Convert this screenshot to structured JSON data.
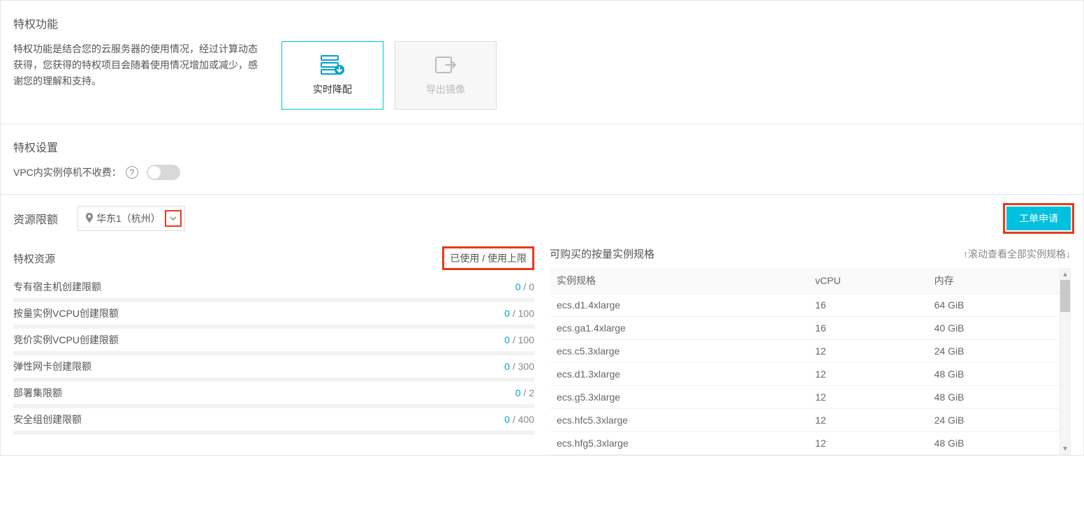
{
  "features": {
    "title": "特权功能",
    "desc": "特权功能是结合您的云服务器的使用情况，经过计算动态获得，您获得的特权项目会随着使用情况增加或减少，感谢您的理解和支持。",
    "cards": {
      "downgrade": "实时降配",
      "export_image": "导出镜像"
    }
  },
  "settings": {
    "title": "特权设置",
    "vpc_stop_no_charge": "VPC内实例停机不收费："
  },
  "quota": {
    "title": "资源限额",
    "region": "华东1（杭州）",
    "apply_label": "工单申请"
  },
  "left": {
    "title": "特权资源",
    "head_right": "已使用 / 使用上限",
    "rows": [
      {
        "label": "专有宿主机创建限额",
        "used": "0",
        "limit": "0"
      },
      {
        "label": "按量实例VCPU创建限额",
        "used": "0",
        "limit": "100"
      },
      {
        "label": "竞价实例VCPU创建限额",
        "used": "0",
        "limit": "100"
      },
      {
        "label": "弹性网卡创建限额",
        "used": "0",
        "limit": "300"
      },
      {
        "label": "部署集限额",
        "used": "0",
        "limit": "2"
      },
      {
        "label": "安全组创建限额",
        "used": "0",
        "limit": "400"
      }
    ]
  },
  "right": {
    "title": "可购买的按量实例规格",
    "scroll_hint": "↑滚动查看全部实例规格↓",
    "columns": {
      "spec": "实例规格",
      "vcpu": "vCPU",
      "mem": "内存"
    },
    "rows": [
      {
        "spec": "ecs.d1.4xlarge",
        "vcpu": "16",
        "mem": "64 GiB"
      },
      {
        "spec": "ecs.ga1.4xlarge",
        "vcpu": "16",
        "mem": "40 GiB"
      },
      {
        "spec": "ecs.c5.3xlarge",
        "vcpu": "12",
        "mem": "24 GiB"
      },
      {
        "spec": "ecs.d1.3xlarge",
        "vcpu": "12",
        "mem": "48 GiB"
      },
      {
        "spec": "ecs.g5.3xlarge",
        "vcpu": "12",
        "mem": "48 GiB"
      },
      {
        "spec": "ecs.hfc5.3xlarge",
        "vcpu": "12",
        "mem": "24 GiB"
      },
      {
        "spec": "ecs.hfg5.3xlarge",
        "vcpu": "12",
        "mem": "48 GiB"
      }
    ]
  }
}
